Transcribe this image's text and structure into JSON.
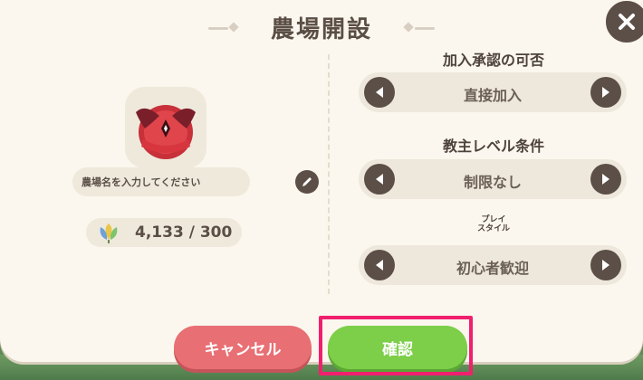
{
  "dialog": {
    "title": "農場開設",
    "close_icon": "close-icon"
  },
  "farm": {
    "emblem_icon": "winged-heart-emblem-icon",
    "name_placeholder": "農場名を入力してください",
    "edit_icon": "pencil-icon"
  },
  "resource": {
    "icon": "leaf-crystal-icon",
    "value": "4,133 / 300"
  },
  "settings": [
    {
      "label": "加入承認の可否",
      "ruby": "",
      "value": "直接加入"
    },
    {
      "label": "教主レベル条件",
      "ruby": "",
      "value": "制限なし"
    },
    {
      "label": "",
      "ruby": "プレイ\nスタイル",
      "value": "初心者歓迎"
    }
  ],
  "buttons": {
    "cancel": "キャンセル",
    "confirm": "確認"
  },
  "colors": {
    "panel": "#fbf7ee",
    "dark": "#5c4f47",
    "cancel": "#e86f73",
    "confirm": "#7dce49",
    "highlight": "#f0206e"
  }
}
